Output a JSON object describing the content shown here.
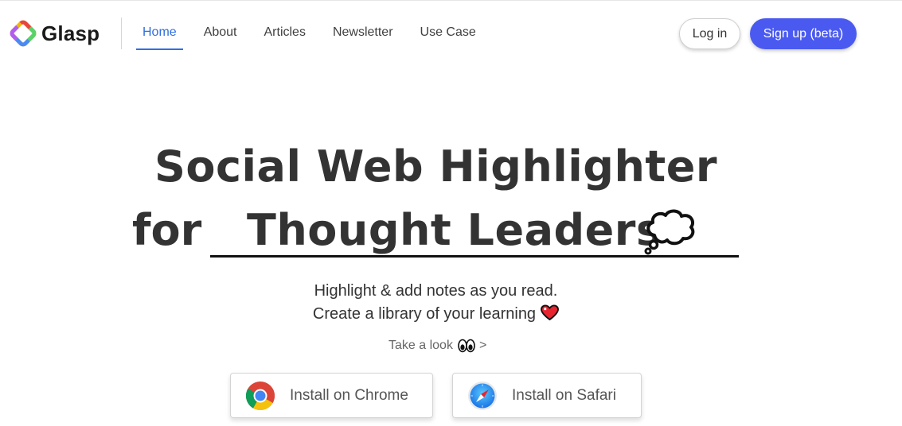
{
  "header": {
    "logo_text": "Glasp",
    "nav": [
      {
        "label": "Home",
        "active": true
      },
      {
        "label": "About",
        "active": false
      },
      {
        "label": "Articles",
        "active": false
      },
      {
        "label": "Newsletter",
        "active": false
      },
      {
        "label": "Use Case",
        "active": false
      }
    ],
    "login_label": "Log in",
    "signup_label": "Sign up (beta)"
  },
  "hero": {
    "headline_line1": "Social Web Highlighter",
    "headline_for": "for",
    "headline_typed": "Thought Leaders",
    "typed_icon": "thought-bubble-icon",
    "subtitle_line1": "Highlight & add notes as you read.",
    "subtitle_line2": "Create a library of your learning",
    "subtitle_icon": "heart-icon",
    "take_look_label": "Take a look",
    "take_look_icon": "eyes-icon",
    "take_look_arrow": ">"
  },
  "install": {
    "chrome_label": "Install on Chrome",
    "safari_label": "Install on Safari"
  },
  "colors": {
    "accent": "#2f6fe0",
    "signup_bg": "#4a5af0",
    "heading": "#333333",
    "heart": "#e8242f"
  }
}
